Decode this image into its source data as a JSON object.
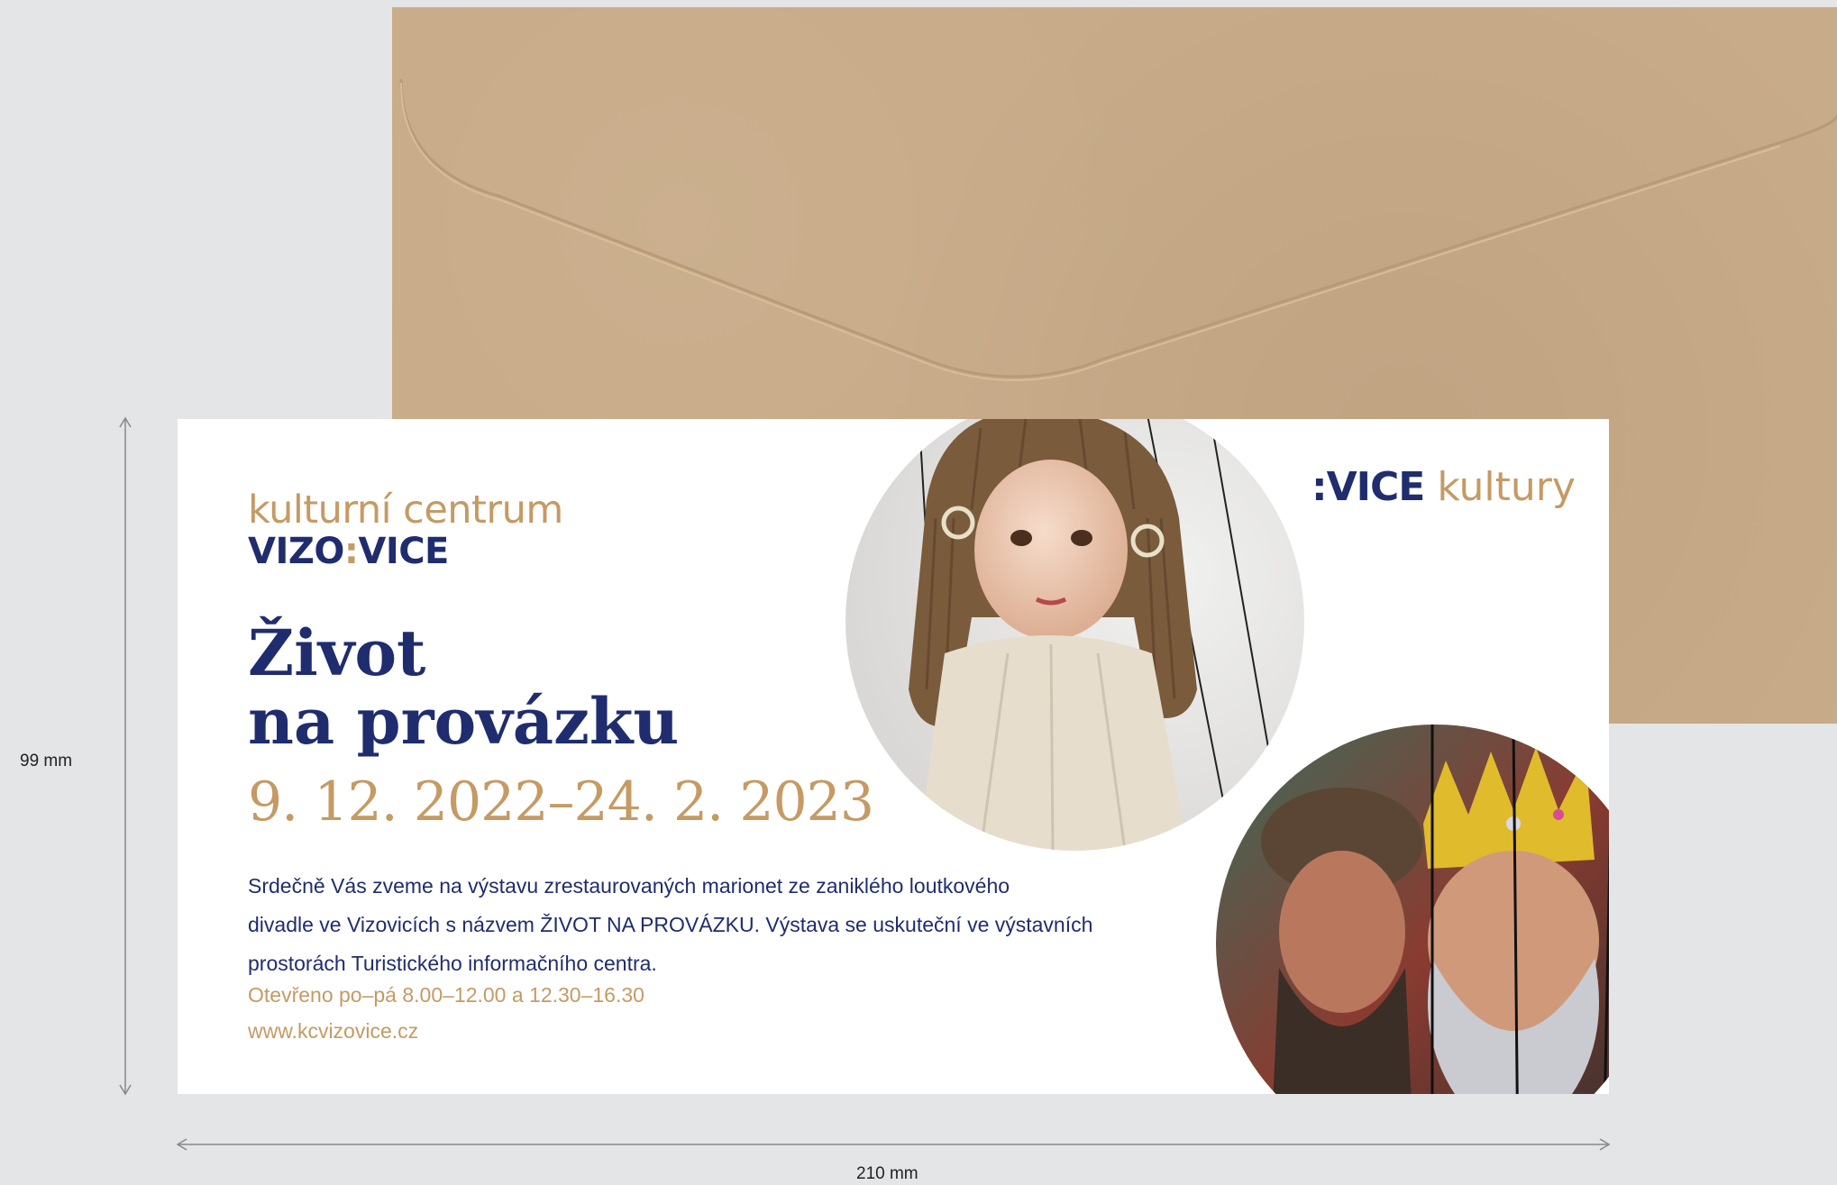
{
  "dimensions": {
    "height_label": "99 mm",
    "width_label": "210 mm"
  },
  "card": {
    "org_name": "kulturní centrum",
    "org_brand_left": "VIZO",
    "org_brand_colon": ":",
    "org_brand_right": "VICE",
    "title_line1": "Život",
    "title_line2": "na provázku",
    "dates": "9. 12. 2022–24. 2. 2023",
    "invite_line1": "Srdečně Vás zveme na výstavu zrestaurovaných marionet ze zaniklého loutkového",
    "invite_line2": "divadle ve Vizovicích s názvem ŽIVOT NA PROVÁZKU. Výstava se uskuteční ve výstavních",
    "invite_line3": "prostorách Turistického informačního centra.",
    "hours": "Otevřeno po–pá 8.00–12.00 a 12.30–16.30",
    "website": "www.kcvizovice.cz",
    "logo_brand": ":VICE",
    "logo_word": "kultury"
  },
  "colors": {
    "navy": "#1f2d6e",
    "gold": "#c59a63",
    "envelope": "#c8ab88",
    "background": "#e4e5e7"
  },
  "images": {
    "top_photo": "marionette-girl-photo",
    "bottom_photo": "marionette-kings-photo"
  }
}
